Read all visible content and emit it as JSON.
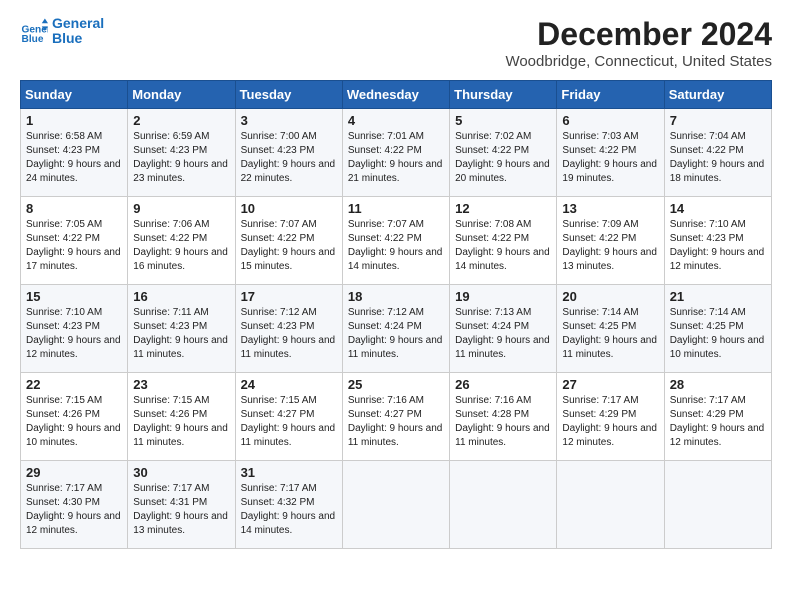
{
  "header": {
    "logo_line1": "General",
    "logo_line2": "Blue",
    "title": "December 2024",
    "subtitle": "Woodbridge, Connecticut, United States"
  },
  "days_of_week": [
    "Sunday",
    "Monday",
    "Tuesday",
    "Wednesday",
    "Thursday",
    "Friday",
    "Saturday"
  ],
  "weeks": [
    [
      {
        "day": 1,
        "sunrise": "6:58 AM",
        "sunset": "4:23 PM",
        "daylight": "9 hours and 24 minutes."
      },
      {
        "day": 2,
        "sunrise": "6:59 AM",
        "sunset": "4:23 PM",
        "daylight": "9 hours and 23 minutes."
      },
      {
        "day": 3,
        "sunrise": "7:00 AM",
        "sunset": "4:23 PM",
        "daylight": "9 hours and 22 minutes."
      },
      {
        "day": 4,
        "sunrise": "7:01 AM",
        "sunset": "4:22 PM",
        "daylight": "9 hours and 21 minutes."
      },
      {
        "day": 5,
        "sunrise": "7:02 AM",
        "sunset": "4:22 PM",
        "daylight": "9 hours and 20 minutes."
      },
      {
        "day": 6,
        "sunrise": "7:03 AM",
        "sunset": "4:22 PM",
        "daylight": "9 hours and 19 minutes."
      },
      {
        "day": 7,
        "sunrise": "7:04 AM",
        "sunset": "4:22 PM",
        "daylight": "9 hours and 18 minutes."
      }
    ],
    [
      {
        "day": 8,
        "sunrise": "7:05 AM",
        "sunset": "4:22 PM",
        "daylight": "9 hours and 17 minutes."
      },
      {
        "day": 9,
        "sunrise": "7:06 AM",
        "sunset": "4:22 PM",
        "daylight": "9 hours and 16 minutes."
      },
      {
        "day": 10,
        "sunrise": "7:07 AM",
        "sunset": "4:22 PM",
        "daylight": "9 hours and 15 minutes."
      },
      {
        "day": 11,
        "sunrise": "7:07 AM",
        "sunset": "4:22 PM",
        "daylight": "9 hours and 14 minutes."
      },
      {
        "day": 12,
        "sunrise": "7:08 AM",
        "sunset": "4:22 PM",
        "daylight": "9 hours and 14 minutes."
      },
      {
        "day": 13,
        "sunrise": "7:09 AM",
        "sunset": "4:22 PM",
        "daylight": "9 hours and 13 minutes."
      },
      {
        "day": 14,
        "sunrise": "7:10 AM",
        "sunset": "4:23 PM",
        "daylight": "9 hours and 12 minutes."
      }
    ],
    [
      {
        "day": 15,
        "sunrise": "7:10 AM",
        "sunset": "4:23 PM",
        "daylight": "9 hours and 12 minutes."
      },
      {
        "day": 16,
        "sunrise": "7:11 AM",
        "sunset": "4:23 PM",
        "daylight": "9 hours and 11 minutes."
      },
      {
        "day": 17,
        "sunrise": "7:12 AM",
        "sunset": "4:23 PM",
        "daylight": "9 hours and 11 minutes."
      },
      {
        "day": 18,
        "sunrise": "7:12 AM",
        "sunset": "4:24 PM",
        "daylight": "9 hours and 11 minutes."
      },
      {
        "day": 19,
        "sunrise": "7:13 AM",
        "sunset": "4:24 PM",
        "daylight": "9 hours and 11 minutes."
      },
      {
        "day": 20,
        "sunrise": "7:14 AM",
        "sunset": "4:25 PM",
        "daylight": "9 hours and 11 minutes."
      },
      {
        "day": 21,
        "sunrise": "7:14 AM",
        "sunset": "4:25 PM",
        "daylight": "9 hours and 10 minutes."
      }
    ],
    [
      {
        "day": 22,
        "sunrise": "7:15 AM",
        "sunset": "4:26 PM",
        "daylight": "9 hours and 10 minutes."
      },
      {
        "day": 23,
        "sunrise": "7:15 AM",
        "sunset": "4:26 PM",
        "daylight": "9 hours and 11 minutes."
      },
      {
        "day": 24,
        "sunrise": "7:15 AM",
        "sunset": "4:27 PM",
        "daylight": "9 hours and 11 minutes."
      },
      {
        "day": 25,
        "sunrise": "7:16 AM",
        "sunset": "4:27 PM",
        "daylight": "9 hours and 11 minutes."
      },
      {
        "day": 26,
        "sunrise": "7:16 AM",
        "sunset": "4:28 PM",
        "daylight": "9 hours and 11 minutes."
      },
      {
        "day": 27,
        "sunrise": "7:17 AM",
        "sunset": "4:29 PM",
        "daylight": "9 hours and 12 minutes."
      },
      {
        "day": 28,
        "sunrise": "7:17 AM",
        "sunset": "4:29 PM",
        "daylight": "9 hours and 12 minutes."
      }
    ],
    [
      {
        "day": 29,
        "sunrise": "7:17 AM",
        "sunset": "4:30 PM",
        "daylight": "9 hours and 12 minutes."
      },
      {
        "day": 30,
        "sunrise": "7:17 AM",
        "sunset": "4:31 PM",
        "daylight": "9 hours and 13 minutes."
      },
      {
        "day": 31,
        "sunrise": "7:17 AM",
        "sunset": "4:32 PM",
        "daylight": "9 hours and 14 minutes."
      },
      null,
      null,
      null,
      null
    ]
  ]
}
